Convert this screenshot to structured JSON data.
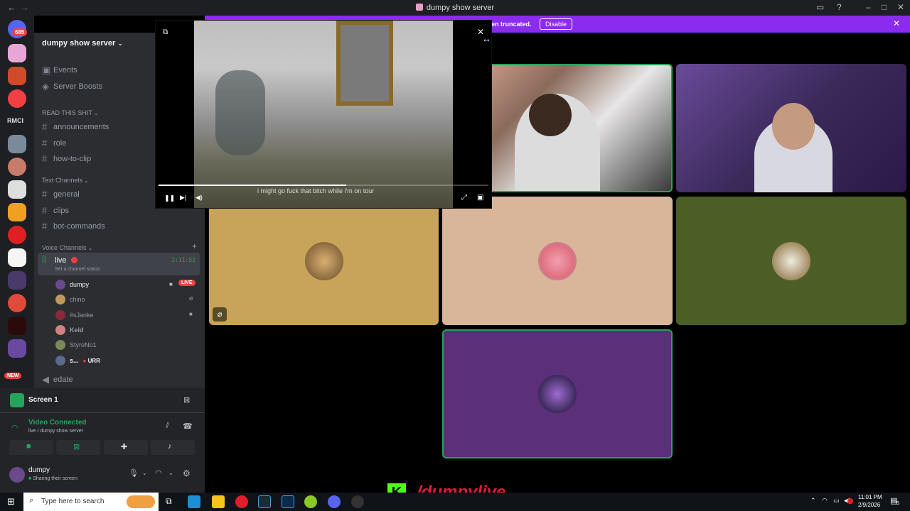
{
  "titlebar": {
    "title": "dumpy show server"
  },
  "rail": {
    "badge_count": "685",
    "rmci_label": "RMCI",
    "new_badge": "NEW"
  },
  "sidebar": {
    "server_name": "dumpy show server",
    "top_items": [
      "Events",
      "Server Boosts"
    ],
    "category_read": "READ THIS SHIT",
    "read_channels": [
      "announcements",
      "role",
      "how-to-clip"
    ],
    "category_text": "Text Channels",
    "text_channels": [
      "general",
      "clips",
      "bot-commands"
    ],
    "category_voice": "Voice Channels",
    "voice_channel": {
      "name": "live",
      "timer": "2:11:52",
      "status_hint": "Set a channel status"
    },
    "voice_users": [
      {
        "name": "dumpy",
        "badge": "LIVE"
      },
      {
        "name": "chino"
      },
      {
        "name": "#sJanke"
      },
      {
        "name": "Keid"
      },
      {
        "name": "StyroNo1"
      },
      {
        "name": "s...",
        "extra": "URR"
      }
    ],
    "other_voice": "edate"
  },
  "voice_panel": {
    "screen_title": "Screen 1",
    "connected": "Video Connected",
    "location": "live  / dumpy show server",
    "user": {
      "name": "dumpy",
      "status": "Sharing their screen"
    }
  },
  "banner": {
    "text": "een truncated.",
    "button": "Disable"
  },
  "player": {
    "subtitle": "i might go fuck that bitch while i'm on tour",
    "progress": 0.57
  },
  "overlay": {
    "handle": "/dumpylive",
    "logo": "K"
  },
  "taskbar": {
    "search_placeholder": "Type here to search",
    "time": "11:01 PM",
    "date": "2/9/2026",
    "notif_count": "5"
  },
  "colors": {
    "accent": "#8b2bf0",
    "green": "#23a55a",
    "tile_tan": "#c8a45a",
    "tile_peach": "#d9b59a",
    "tile_olive": "#4a5e25",
    "tile_purple": "#5b2f7a"
  }
}
